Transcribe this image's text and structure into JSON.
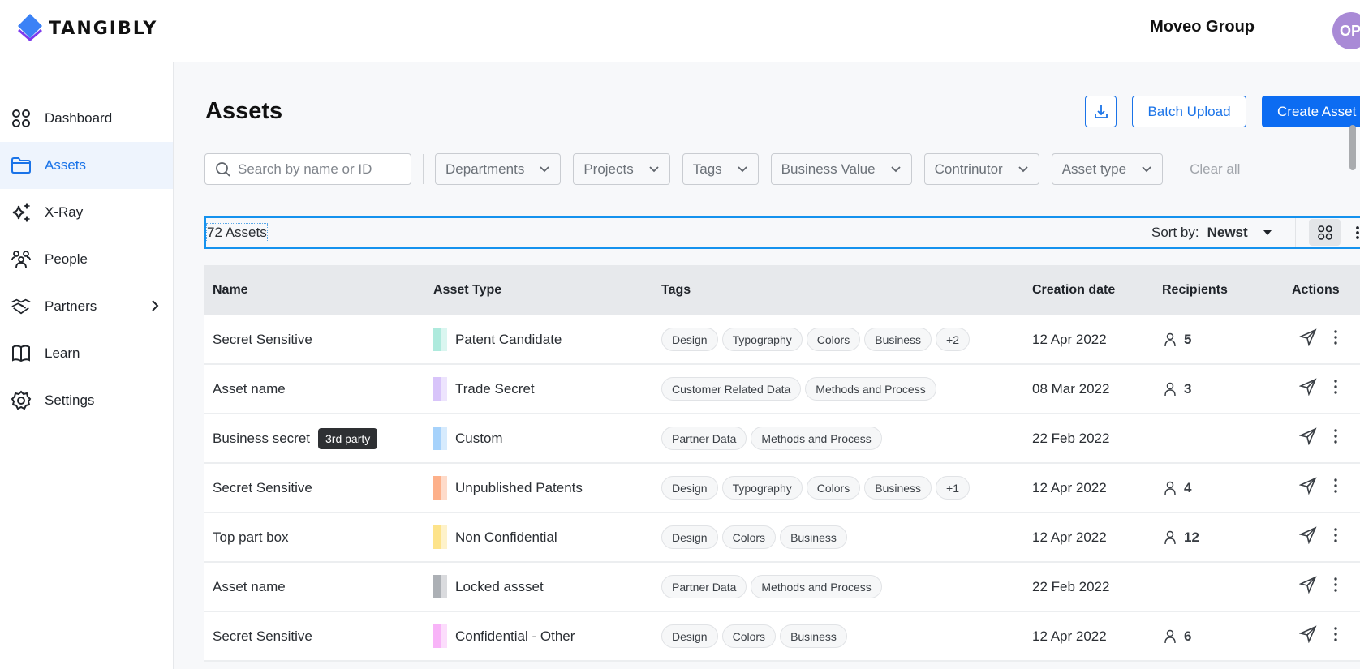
{
  "header": {
    "brand": "TANGIBLY",
    "org_name": "Moveo Group",
    "avatar_initials": "OP",
    "colors": {
      "brand_blue": "#3b82f6",
      "brand_purple": "#7c3aed",
      "avatar_bg": "#a98ad6"
    }
  },
  "sidebar": {
    "items": [
      {
        "label": "Dashboard",
        "icon": "dashboard-icon",
        "active": false
      },
      {
        "label": "Assets",
        "icon": "folder-icon",
        "active": true
      },
      {
        "label": "X-Ray",
        "icon": "sparkles-icon",
        "active": false
      },
      {
        "label": "People",
        "icon": "people-icon",
        "active": false
      },
      {
        "label": "Partners",
        "icon": "handshake-icon",
        "active": false,
        "has_submenu": true
      },
      {
        "label": "Learn",
        "icon": "book-icon",
        "active": false
      },
      {
        "label": "Settings",
        "icon": "gear-icon",
        "active": false
      }
    ]
  },
  "main": {
    "title": "Assets",
    "download_icon": "download-icon",
    "batch_upload_label": "Batch Upload",
    "create_asset_label": "Create Asset",
    "accent": "#0c6cf2",
    "filters": {
      "search_placeholder": "Search by name or ID",
      "dropdowns": [
        "Departments",
        "Projects",
        "Tags",
        "Business Value",
        "Contrinutor",
        "Asset type"
      ],
      "clear_all_label": "Clear all"
    },
    "count_label": "72 Assets",
    "sort": {
      "label": "Sort by:",
      "value": "Newst"
    },
    "view": {
      "grid_icon": "grid-view-icon",
      "list_icon": "list-view-icon",
      "selected": "grid"
    }
  },
  "table": {
    "columns": [
      "Name",
      "Asset Type",
      "Tags",
      "Creation date",
      "Recipients",
      "Actions"
    ],
    "rows": [
      {
        "name": "Secret Sensitive",
        "badge": "",
        "type": "Patent Candidate",
        "type_color": "#aeeadd",
        "tags": [
          "Design",
          "Typography",
          "Colors",
          "Business",
          "+2"
        ],
        "date": "12 Apr 2022",
        "recipients": "5"
      },
      {
        "name": "Asset name",
        "badge": "",
        "type": "Trade Secret",
        "type_color": "#d8c4fa",
        "tags": [
          "Customer Related Data",
          "Methods and Process"
        ],
        "date": "08 Mar 2022",
        "recipients": "3"
      },
      {
        "name": "Business secret",
        "badge": "3rd party",
        "type": "Custom",
        "type_color": "#a6d2fb",
        "tags": [
          "Partner Data",
          "Methods and Process"
        ],
        "date": "22 Feb 2022",
        "recipients": ""
      },
      {
        "name": "Secret Sensitive",
        "badge": "",
        "type": "Unpublished Patents",
        "type_color": "#fdb08a",
        "tags": [
          "Design",
          "Typography",
          "Colors",
          "Business",
          "+1"
        ],
        "date": "12 Apr 2022",
        "recipients": "4"
      },
      {
        "name": "Top part box",
        "badge": "",
        "type": "Non Confidential",
        "type_color": "#fde38a",
        "tags": [
          "Design",
          "Colors",
          "Business"
        ],
        "date": "12 Apr 2022",
        "recipients": "12"
      },
      {
        "name": "Asset name",
        "badge": "",
        "type": "Locked assset",
        "type_color": "#acb0b5",
        "tags": [
          "Partner Data",
          "Methods and Process"
        ],
        "date": "22 Feb 2022",
        "recipients": ""
      },
      {
        "name": "Secret Sensitive",
        "badge": "",
        "type": "Confidential - Other",
        "type_color": "#f8b4f8",
        "tags": [
          "Design",
          "Colors",
          "Business"
        ],
        "date": "12 Apr 2022",
        "recipients": "6"
      }
    ]
  }
}
